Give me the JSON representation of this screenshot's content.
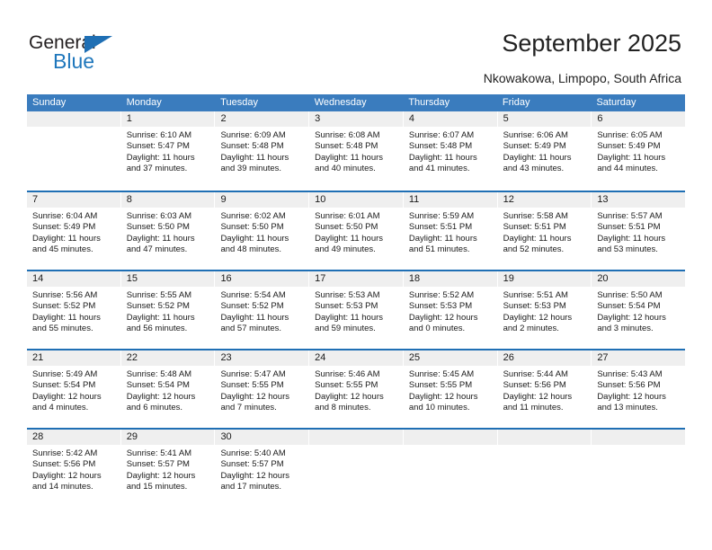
{
  "logo": {
    "word_one": "General",
    "word_two": "Blue",
    "triangle": "triangle-icon",
    "brand_color": "#1f77bc"
  },
  "header": {
    "title": "September 2025",
    "subtitle": "Nkowakowa, Limpopo, South Africa"
  },
  "calendar": {
    "header_bg": "#3a7cbe",
    "row_rule_color": "#1f6fb4",
    "daynum_bg": "#efefef",
    "weekdays": [
      "Sunday",
      "Monday",
      "Tuesday",
      "Wednesday",
      "Thursday",
      "Friday",
      "Saturday"
    ],
    "weeks": [
      [
        {
          "day": "",
          "empty": true,
          "sunrise": "",
          "sunset": "",
          "daylight1": "",
          "daylight2": ""
        },
        {
          "day": "1",
          "sunrise": "Sunrise: 6:10 AM",
          "sunset": "Sunset: 5:47 PM",
          "daylight1": "Daylight: 11 hours",
          "daylight2": "and 37 minutes."
        },
        {
          "day": "2",
          "sunrise": "Sunrise: 6:09 AM",
          "sunset": "Sunset: 5:48 PM",
          "daylight1": "Daylight: 11 hours",
          "daylight2": "and 39 minutes."
        },
        {
          "day": "3",
          "sunrise": "Sunrise: 6:08 AM",
          "sunset": "Sunset: 5:48 PM",
          "daylight1": "Daylight: 11 hours",
          "daylight2": "and 40 minutes."
        },
        {
          "day": "4",
          "sunrise": "Sunrise: 6:07 AM",
          "sunset": "Sunset: 5:48 PM",
          "daylight1": "Daylight: 11 hours",
          "daylight2": "and 41 minutes."
        },
        {
          "day": "5",
          "sunrise": "Sunrise: 6:06 AM",
          "sunset": "Sunset: 5:49 PM",
          "daylight1": "Daylight: 11 hours",
          "daylight2": "and 43 minutes."
        },
        {
          "day": "6",
          "sunrise": "Sunrise: 6:05 AM",
          "sunset": "Sunset: 5:49 PM",
          "daylight1": "Daylight: 11 hours",
          "daylight2": "and 44 minutes."
        }
      ],
      [
        {
          "day": "7",
          "sunrise": "Sunrise: 6:04 AM",
          "sunset": "Sunset: 5:49 PM",
          "daylight1": "Daylight: 11 hours",
          "daylight2": "and 45 minutes."
        },
        {
          "day": "8",
          "sunrise": "Sunrise: 6:03 AM",
          "sunset": "Sunset: 5:50 PM",
          "daylight1": "Daylight: 11 hours",
          "daylight2": "and 47 minutes."
        },
        {
          "day": "9",
          "sunrise": "Sunrise: 6:02 AM",
          "sunset": "Sunset: 5:50 PM",
          "daylight1": "Daylight: 11 hours",
          "daylight2": "and 48 minutes."
        },
        {
          "day": "10",
          "sunrise": "Sunrise: 6:01 AM",
          "sunset": "Sunset: 5:50 PM",
          "daylight1": "Daylight: 11 hours",
          "daylight2": "and 49 minutes."
        },
        {
          "day": "11",
          "sunrise": "Sunrise: 5:59 AM",
          "sunset": "Sunset: 5:51 PM",
          "daylight1": "Daylight: 11 hours",
          "daylight2": "and 51 minutes."
        },
        {
          "day": "12",
          "sunrise": "Sunrise: 5:58 AM",
          "sunset": "Sunset: 5:51 PM",
          "daylight1": "Daylight: 11 hours",
          "daylight2": "and 52 minutes."
        },
        {
          "day": "13",
          "sunrise": "Sunrise: 5:57 AM",
          "sunset": "Sunset: 5:51 PM",
          "daylight1": "Daylight: 11 hours",
          "daylight2": "and 53 minutes."
        }
      ],
      [
        {
          "day": "14",
          "sunrise": "Sunrise: 5:56 AM",
          "sunset": "Sunset: 5:52 PM",
          "daylight1": "Daylight: 11 hours",
          "daylight2": "and 55 minutes."
        },
        {
          "day": "15",
          "sunrise": "Sunrise: 5:55 AM",
          "sunset": "Sunset: 5:52 PM",
          "daylight1": "Daylight: 11 hours",
          "daylight2": "and 56 minutes."
        },
        {
          "day": "16",
          "sunrise": "Sunrise: 5:54 AM",
          "sunset": "Sunset: 5:52 PM",
          "daylight1": "Daylight: 11 hours",
          "daylight2": "and 57 minutes."
        },
        {
          "day": "17",
          "sunrise": "Sunrise: 5:53 AM",
          "sunset": "Sunset: 5:53 PM",
          "daylight1": "Daylight: 11 hours",
          "daylight2": "and 59 minutes."
        },
        {
          "day": "18",
          "sunrise": "Sunrise: 5:52 AM",
          "sunset": "Sunset: 5:53 PM",
          "daylight1": "Daylight: 12 hours",
          "daylight2": "and 0 minutes."
        },
        {
          "day": "19",
          "sunrise": "Sunrise: 5:51 AM",
          "sunset": "Sunset: 5:53 PM",
          "daylight1": "Daylight: 12 hours",
          "daylight2": "and 2 minutes."
        },
        {
          "day": "20",
          "sunrise": "Sunrise: 5:50 AM",
          "sunset": "Sunset: 5:54 PM",
          "daylight1": "Daylight: 12 hours",
          "daylight2": "and 3 minutes."
        }
      ],
      [
        {
          "day": "21",
          "sunrise": "Sunrise: 5:49 AM",
          "sunset": "Sunset: 5:54 PM",
          "daylight1": "Daylight: 12 hours",
          "daylight2": "and 4 minutes."
        },
        {
          "day": "22",
          "sunrise": "Sunrise: 5:48 AM",
          "sunset": "Sunset: 5:54 PM",
          "daylight1": "Daylight: 12 hours",
          "daylight2": "and 6 minutes."
        },
        {
          "day": "23",
          "sunrise": "Sunrise: 5:47 AM",
          "sunset": "Sunset: 5:55 PM",
          "daylight1": "Daylight: 12 hours",
          "daylight2": "and 7 minutes."
        },
        {
          "day": "24",
          "sunrise": "Sunrise: 5:46 AM",
          "sunset": "Sunset: 5:55 PM",
          "daylight1": "Daylight: 12 hours",
          "daylight2": "and 8 minutes."
        },
        {
          "day": "25",
          "sunrise": "Sunrise: 5:45 AM",
          "sunset": "Sunset: 5:55 PM",
          "daylight1": "Daylight: 12 hours",
          "daylight2": "and 10 minutes."
        },
        {
          "day": "26",
          "sunrise": "Sunrise: 5:44 AM",
          "sunset": "Sunset: 5:56 PM",
          "daylight1": "Daylight: 12 hours",
          "daylight2": "and 11 minutes."
        },
        {
          "day": "27",
          "sunrise": "Sunrise: 5:43 AM",
          "sunset": "Sunset: 5:56 PM",
          "daylight1": "Daylight: 12 hours",
          "daylight2": "and 13 minutes."
        }
      ],
      [
        {
          "day": "28",
          "sunrise": "Sunrise: 5:42 AM",
          "sunset": "Sunset: 5:56 PM",
          "daylight1": "Daylight: 12 hours",
          "daylight2": "and 14 minutes."
        },
        {
          "day": "29",
          "sunrise": "Sunrise: 5:41 AM",
          "sunset": "Sunset: 5:57 PM",
          "daylight1": "Daylight: 12 hours",
          "daylight2": "and 15 minutes."
        },
        {
          "day": "30",
          "sunrise": "Sunrise: 5:40 AM",
          "sunset": "Sunset: 5:57 PM",
          "daylight1": "Daylight: 12 hours",
          "daylight2": "and 17 minutes."
        },
        {
          "day": "",
          "empty": true,
          "sunrise": "",
          "sunset": "",
          "daylight1": "",
          "daylight2": ""
        },
        {
          "day": "",
          "empty": true,
          "sunrise": "",
          "sunset": "",
          "daylight1": "",
          "daylight2": ""
        },
        {
          "day": "",
          "empty": true,
          "sunrise": "",
          "sunset": "",
          "daylight1": "",
          "daylight2": ""
        },
        {
          "day": "",
          "empty": true,
          "sunrise": "",
          "sunset": "",
          "daylight1": "",
          "daylight2": ""
        }
      ]
    ]
  }
}
